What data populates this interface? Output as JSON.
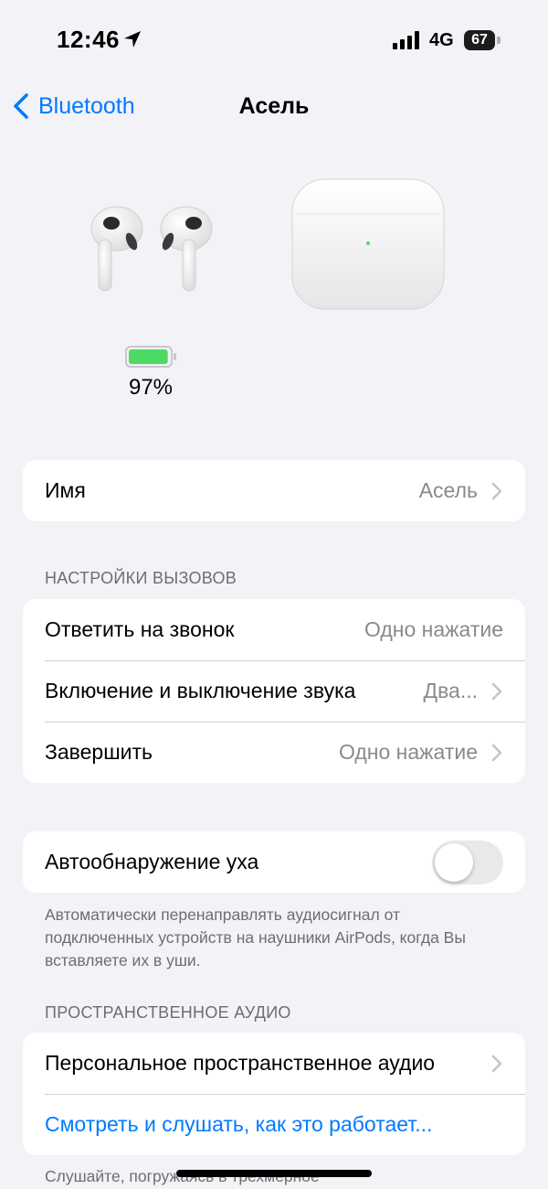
{
  "status_bar": {
    "time": "12:46",
    "network": "4G",
    "battery_level": "67"
  },
  "nav": {
    "back_label": "Bluetooth",
    "title": "Асель"
  },
  "device": {
    "battery_percent": "97%",
    "battery_fraction": 0.97,
    "battery_color": "#4cd964"
  },
  "name_group": {
    "label": "Имя",
    "value": "Асель"
  },
  "call_settings": {
    "header": "НАСТРОЙКИ ВЫЗОВОВ",
    "rows": [
      {
        "label": "Ответить на звонок",
        "value": "Одно нажатие"
      },
      {
        "label": "Включение и выключение звука",
        "value": "Два..."
      },
      {
        "label": "Завершить",
        "value": "Одно нажатие"
      }
    ]
  },
  "ear_detection": {
    "label": "Автообнаружение уха",
    "enabled": false,
    "footnote": "Автоматически перенаправлять аудиосигнал от подключенных устройств на наушники AirPods, когда Вы вставляете их в уши."
  },
  "spatial_audio": {
    "header": "ПРОСТРАНСТВЕННОЕ АУДИО",
    "personal_label": "Персональное пространственное аудио",
    "link_label": "Смотреть и слушать, как это работает...",
    "footnote": "Слушайте, погружаясь в трехмерное"
  },
  "colors": {
    "accent": "#007aff",
    "background": "#f2f2f7",
    "secondary_text": "#8a8a8e"
  }
}
